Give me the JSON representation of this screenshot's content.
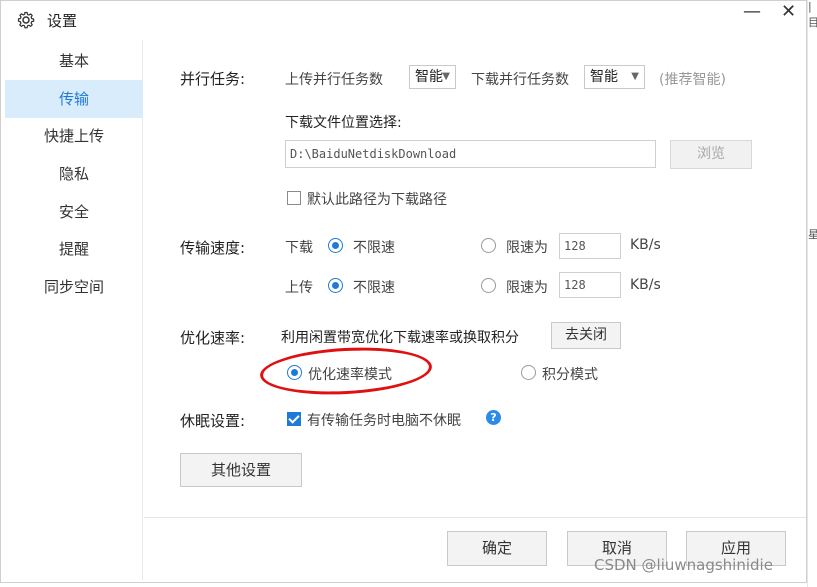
{
  "window": {
    "title": "设置",
    "minimize_glyph": "—",
    "close_glyph": "✕",
    "icon": "gear-icon"
  },
  "right_strip": {
    "glyph_top": "|",
    "glyph_mid": "目",
    "glyph_low": "星"
  },
  "sidebar": {
    "items": [
      {
        "label": "基本",
        "active": false
      },
      {
        "label": "传输",
        "active": true
      },
      {
        "label": "快捷上传",
        "active": false
      },
      {
        "label": "隐私",
        "active": false
      },
      {
        "label": "安全",
        "active": false
      },
      {
        "label": "提醒",
        "active": false
      },
      {
        "label": "同步空间",
        "active": false
      }
    ]
  },
  "parallel": {
    "label": "并行任务:",
    "upload_label": "上传并行任务数",
    "upload_value": "智能",
    "download_label": "下载并行任务数",
    "download_value": "智能",
    "hint": "(推荐智能)"
  },
  "download_location": {
    "label": "下载文件位置选择:",
    "path": "D:\\BaiduNetdiskDownload",
    "browse_label": "浏览",
    "default_checkbox_label": "默认此路径为下载路径",
    "default_checked": false
  },
  "speed": {
    "label": "传输速度:",
    "download_label": "下载",
    "upload_label": "上传",
    "unlimited_label": "不限速",
    "limit_label": "限速为",
    "download_limit": "128",
    "upload_limit": "128",
    "unit": "KB/s",
    "download_mode": "unlimited",
    "upload_mode": "unlimited"
  },
  "optimize": {
    "label": "优化速率:",
    "description": "利用闲置带宽优化下载速率或换取积分",
    "close_button": "去关闭",
    "mode_speed_label": "优化速率模式",
    "mode_points_label": "积分模式",
    "selected_mode": "speed",
    "annotation_color": "#e01010"
  },
  "sleep": {
    "label": "休眠设置:",
    "checkbox_label": "有传输任务时电脑不休眠",
    "checked": true,
    "help_glyph": "?"
  },
  "other_settings_button": "其他设置",
  "footer": {
    "ok": "确定",
    "cancel": "取消",
    "apply": "应用"
  },
  "watermark": "CSDN @liuwnagshinidie",
  "colors": {
    "accent": "#1e7ad6",
    "active_bg": "#d9ecfb"
  }
}
